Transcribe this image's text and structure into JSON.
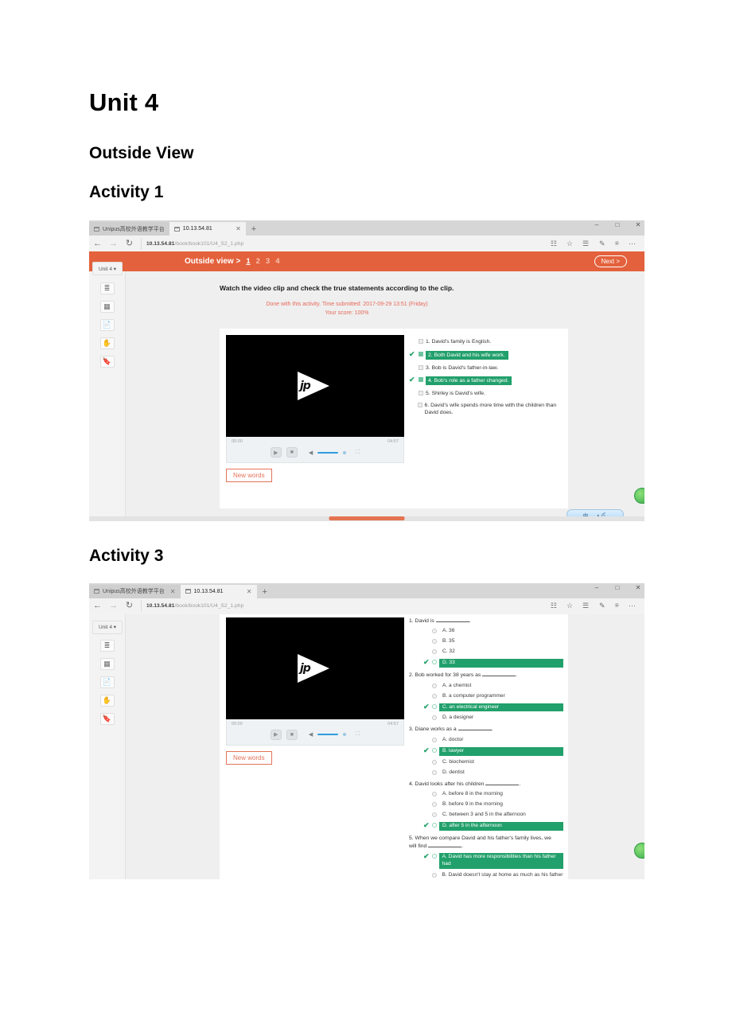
{
  "document": {
    "title": "Unit 4",
    "section": "Outside View",
    "activity1_heading": "Activity 1",
    "activity3_heading": "Activity 3"
  },
  "browser": {
    "tabs": [
      {
        "title": "Unipus高校外语教学平台",
        "active": false
      },
      {
        "title": "10.13.54.81",
        "active": true
      }
    ],
    "new_tab_label": "+",
    "window_controls": {
      "minimize": "–",
      "maximize": "□",
      "close": "✕"
    },
    "nav": {
      "back": "←",
      "forward": "→",
      "refresh": "↻"
    },
    "url_host": "10.13.54.81",
    "url_path": "/book/book101/U4_S2_1.php",
    "toolbar_icons": [
      "reading-view-icon",
      "favorite-star-icon",
      "hub-icon",
      "web-note-icon",
      "share-icon",
      "more-icon"
    ]
  },
  "app": {
    "unit_button": "Unit 4 ▾",
    "breadcrumb": "Outside view >",
    "pages": [
      "1",
      "2",
      "3",
      "4"
    ],
    "current_page": "1",
    "next_button": "Next >",
    "rail_icons": [
      "list-icon",
      "book-icon",
      "document-icon",
      "hand-icon",
      "bookmark-icon"
    ],
    "new_words_button": "New words",
    "ime_text": "中 、 ◑ ⛏"
  },
  "video": {
    "logo": "jp",
    "current_time": "00:00",
    "duration": "04:57",
    "play_label": "▶",
    "stop_label": "■",
    "volume_label": "🔈",
    "fullscreen_label": "⤢"
  },
  "activity1": {
    "prompt": "Watch the video clip and check the true statements according to the clip.",
    "status_line1": "Done with this activity. Time submitted: 2017-09-29 13:51 (Friday)",
    "status_line2": "Your score: 100%",
    "statements": [
      {
        "num": "1.",
        "text": "David's family is English.",
        "selected": false
      },
      {
        "num": "2.",
        "text": "Both David and his wife work.",
        "selected": true
      },
      {
        "num": "3.",
        "text": "Bob is David's father-in-law.",
        "selected": false
      },
      {
        "num": "4.",
        "text": "Bob's role as a father changed.",
        "selected": true
      },
      {
        "num": "5.",
        "text": "Shirley is David's wife.",
        "selected": false
      },
      {
        "num": "6.",
        "text": "David's wife spends more time with the children than David does.",
        "selected": false
      }
    ],
    "tick_glyph": "✔"
  },
  "activity3": {
    "questions": [
      {
        "stem_pre": "1. David is ",
        "stem_post": ".",
        "options": [
          {
            "text": "A. 36",
            "selected": false
          },
          {
            "text": "B. 35",
            "selected": false
          },
          {
            "text": "C. 32",
            "selected": false
          },
          {
            "text": "D. 33",
            "selected": true
          }
        ]
      },
      {
        "stem_pre": "2. Bob worked for 38 years as ",
        "stem_post": ".",
        "options": [
          {
            "text": "A. a chemist",
            "selected": false
          },
          {
            "text": "B. a computer programmer",
            "selected": false
          },
          {
            "text": "C. an electrical engineer",
            "selected": true
          },
          {
            "text": "D. a designer",
            "selected": false
          }
        ]
      },
      {
        "stem_pre": "3. Diane works as a ",
        "stem_post": ".",
        "options": [
          {
            "text": "A. doctor",
            "selected": false
          },
          {
            "text": "B. lawyer",
            "selected": true
          },
          {
            "text": "C. biochemist",
            "selected": false
          },
          {
            "text": "D. dentist",
            "selected": false
          }
        ]
      },
      {
        "stem_pre": "4. David looks after his children ",
        "stem_post": ".",
        "options": [
          {
            "text": "A. before 8 in the morning",
            "selected": false
          },
          {
            "text": "B. before 9 in the morning",
            "selected": false
          },
          {
            "text": "C. between 3 and 5 in the afternoon",
            "selected": false
          },
          {
            "text": "D. after 5 in the afternoon",
            "selected": true
          }
        ]
      },
      {
        "stem_pre": "5. When we compare David and his father's family lives, we will find ",
        "stem_post": ".",
        "options": [
          {
            "text": "A. David has more responsibilities than his father had",
            "selected": true
          },
          {
            "text": "B. David doesn't stay at home as much as his father did",
            "selected": false
          }
        ]
      }
    ],
    "tick_glyph": "✔"
  }
}
